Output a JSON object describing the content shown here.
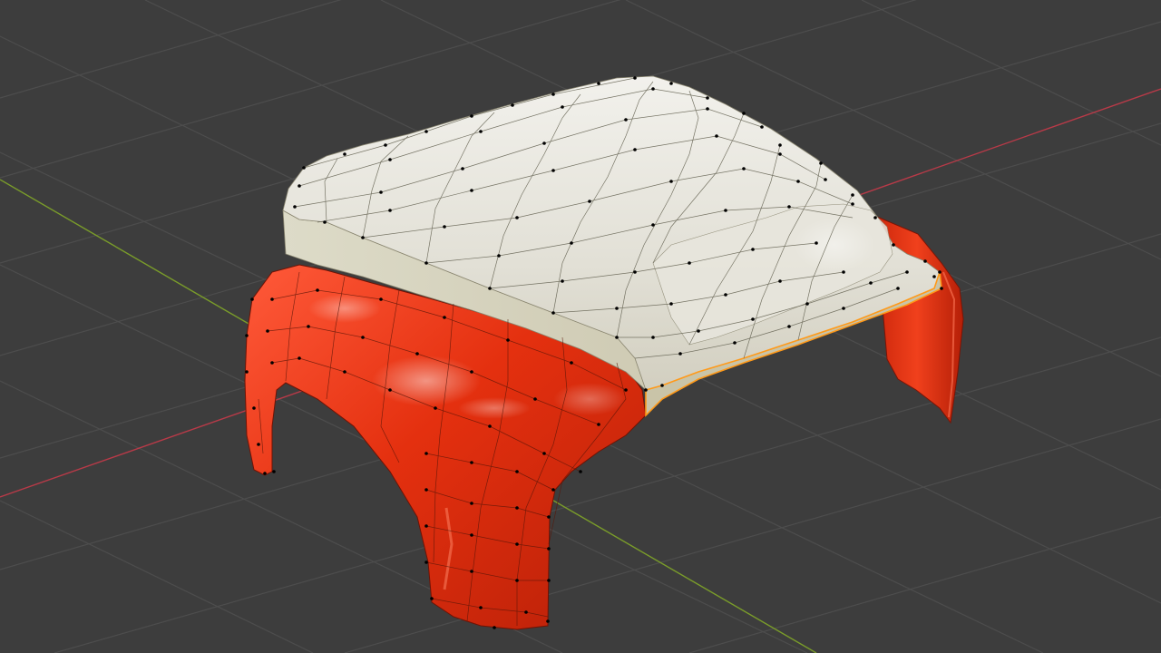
{
  "app": {
    "window": "3d-viewport",
    "mode": "edit-mode",
    "shading": "material-preview"
  },
  "viewport": {
    "background": "#3d3d3d",
    "grid_color": "#505050",
    "x_axis_color": "#b83a48",
    "y_axis_color": "#7a9c2a",
    "vertex_color": "#000000",
    "wire_color": "#3a3a3a",
    "selected_edge_color": "#ff9a1a"
  },
  "model": {
    "body_color": "#e03010",
    "roof_color": "#e6e4dc"
  }
}
